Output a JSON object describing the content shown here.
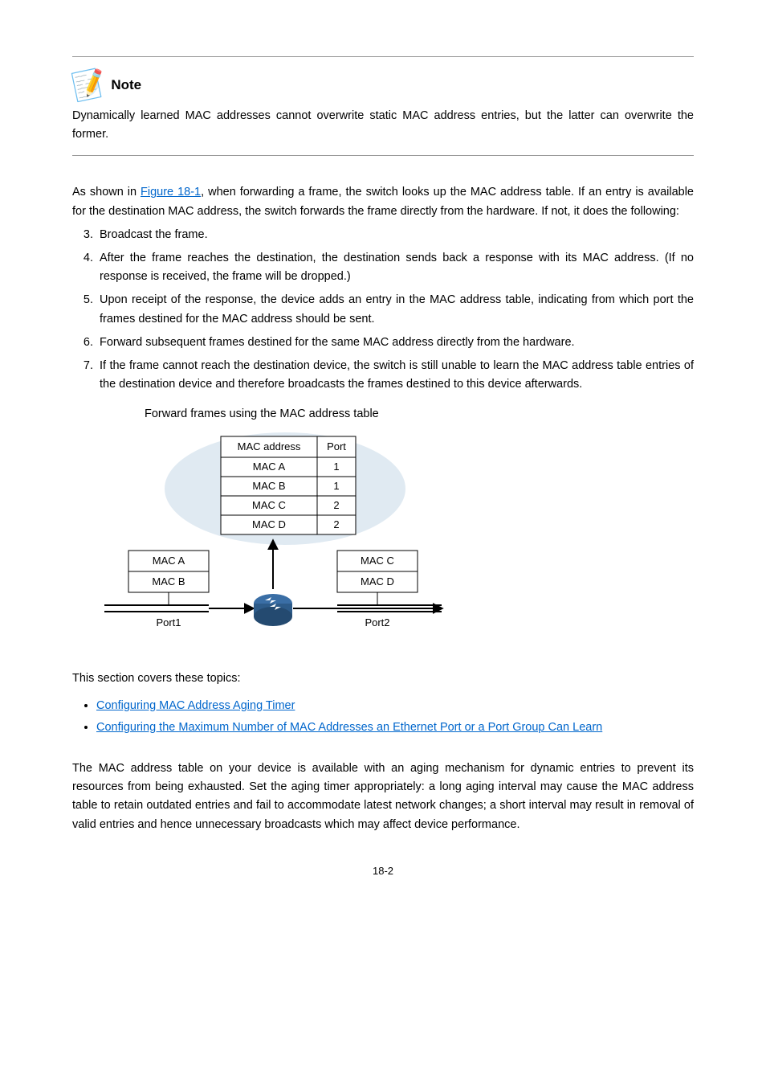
{
  "note": {
    "label": "Note",
    "text": "Dynamically learned MAC addresses cannot overwrite static MAC address entries, but the latter can overwrite the former."
  },
  "para1a": "As shown in ",
  "para1link": "Figure 18-1",
  "para1b": ", when forwarding a frame, the switch looks up the MAC address table. If an entry is available for the destination MAC address, the switch forwards the frame directly from the hardware. If not, it does the following:",
  "list": {
    "li3": "Broadcast the frame.",
    "li4": "After the frame reaches the destination, the destination sends back a response with its MAC address. (If no response is received, the frame will be dropped.)",
    "li5": "Upon receipt of the response, the device adds an entry in the MAC address table, indicating from which port the frames destined for the MAC address should be sent.",
    "li6": "Forward subsequent frames destined for the same MAC address directly from the hardware.",
    "li7": "If the frame cannot reach the destination device, the switch is still unable to learn the MAC address table entries of the destination device and therefore broadcasts the frames destined to this device afterwards."
  },
  "fig_caption": "Forward frames using the MAC address table",
  "chart_data": {
    "type": "table",
    "title": "MAC address table",
    "columns": [
      "MAC address",
      "Port"
    ],
    "rows": [
      [
        "MAC A",
        1
      ],
      [
        "MAC B",
        1
      ],
      [
        "MAC C",
        2
      ],
      [
        "MAC D",
        2
      ]
    ],
    "left_port": {
      "name": "Port1",
      "hosts": [
        "MAC A",
        "MAC B"
      ]
    },
    "right_port": {
      "name": "Port2",
      "hosts": [
        "MAC C",
        "MAC D"
      ]
    }
  },
  "sec_intro": "This section covers these topics:",
  "links": {
    "l1": "Configuring MAC Address Aging Timer",
    "l2": "Configuring the Maximum Number of MAC Addresses an Ethernet Port or a Port Group Can Learn"
  },
  "sub_para": "The MAC address table on your device is available with an aging mechanism for dynamic entries to prevent its resources from being exhausted. Set the aging timer appropriately: a long aging interval may cause the MAC address table to retain outdated entries and fail to accommodate latest network changes; a short interval may result in removal of valid entries and hence unnecessary broadcasts which may affect device performance.",
  "pgnum": "18-2"
}
